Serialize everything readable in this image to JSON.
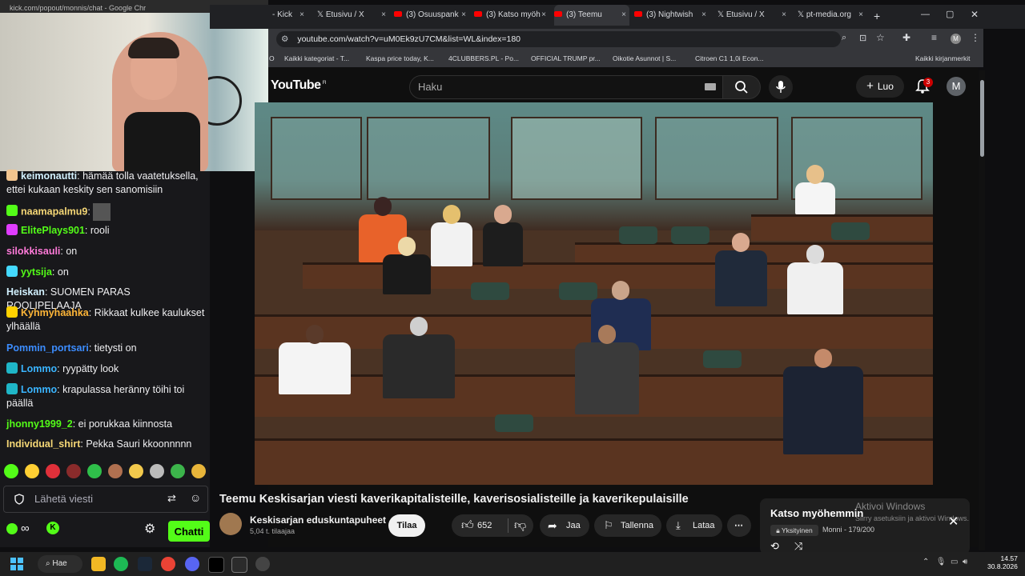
{
  "webcam": {
    "tab_text": "kick.com/popout/monnis/chat - Google Chr"
  },
  "chat": {
    "messages": [
      {
        "name": "keimonautti",
        "color": "#d2f1ff",
        "text": "hämää tolla vaatetuksella, ettei kukaan keskity sen sanomisiin",
        "badge": "#f3c58f"
      },
      {
        "name": "naamapalmu9",
        "color": "#f5d776",
        "text": "",
        "badge": "#53fc18"
      },
      {
        "name": "ElitePlays901",
        "color": "#53fc18",
        "text": "rooli",
        "badge": "#e03cff"
      },
      {
        "name": "silokkisauli",
        "color": "#ff7ad9",
        "text": "on",
        "badge": ""
      },
      {
        "name": "yytsija",
        "color": "#53fc18",
        "text": "on",
        "badge": "#44d9ff"
      },
      {
        "name": "Heiskan",
        "color": "#d2f1ff",
        "text": "SUOMEN PARAS ROOLIPELAAJA",
        "badge": ""
      },
      {
        "name": "Kyhmyhaahka",
        "color": "#ffb638",
        "text": "Rikkaat kulkee kaulukset ylhäällä",
        "badge": "#ffd200"
      },
      {
        "name": "Pommin_portsari",
        "color": "#3c8dff",
        "text": "tietysti on",
        "badge": ""
      },
      {
        "name": "Lommo",
        "color": "#3ab5ff",
        "text": "ryypätty look",
        "badge": "#1fb6c7"
      },
      {
        "name": "Lommo",
        "color": "#3ab5ff",
        "text": "krapulassa heränny töihi toi päällä",
        "badge": "#1fb6c7"
      },
      {
        "name": "jhonny1999_2",
        "color": "#53fc18",
        "text": "ei porukkaa kiinnosta",
        "badge": ""
      },
      {
        "name": "Individual_shirt",
        "color": "#f5d776",
        "text": "Pekka Sauri kkoonnnnn",
        "badge": ""
      }
    ],
    "input_placeholder": "Lähetä viesti",
    "send_label": "Chatti"
  },
  "browser": {
    "tabs": [
      {
        "label": "- Kick",
        "icon": "kick-icon"
      },
      {
        "label": "Etusivu / X",
        "icon": "x-icon"
      },
      {
        "label": "(3) Osuuspank",
        "icon": "youtube-icon"
      },
      {
        "label": "(3) Katso myöh",
        "icon": "youtube-icon"
      },
      {
        "label": "(3) Teemu",
        "icon": "youtube-icon"
      },
      {
        "label": "(3) Nightwish",
        "icon": "youtube-icon"
      },
      {
        "label": "Etusivu / X",
        "icon": "x-icon"
      },
      {
        "label": "pt-media.org",
        "icon": "x-icon"
      }
    ],
    "url": "youtube.com/watch?v=uM0Ek9zU7CM&list=WL&index=180",
    "bookmarks": [
      "O",
      "Kaikki kategoriat - T...",
      "Kaspa price today, K...",
      "4CLUBBERS.PL - Po...",
      "OFFICIAL TRUMP pr...",
      "Oikotie Asunnot | S...",
      "Citroen C1 1,0i Econ...",
      "Kaikki kirjanmerkit"
    ]
  },
  "youtube": {
    "logo": "YouTube",
    "logo_region": "FI",
    "search_placeholder": "Haku",
    "create_label": "Luo",
    "notification_count": "3",
    "avatar_letter": "M",
    "video_title": "Teemu Keskisarjan viesti kaverikapitalisteille, kaverisosialisteille ja kaverikepulaisille",
    "channel_name": "Keskisarjan eduskuntapuheet",
    "channel_subs": "5,04 t. tilaajaa",
    "subscribe_label": "Tilaa",
    "like_count": "652",
    "share_label": "Jaa",
    "save_label": "Tallenna",
    "download_label": "Lataa",
    "watch_later_title": "Katso myöhemmin",
    "privacy_label": "Yksityinen",
    "playlist_owner": "Monni - 179/200",
    "activate_windows": "Aktivoi Windows",
    "activate_windows_sub": "Siirry asetuksiin ja aktivoi Windows."
  },
  "taskbar": {
    "search_label": "Hae",
    "time": "14.57",
    "date": "30.8.2026"
  },
  "colors": {
    "kick_green": "#53fc18",
    "youtube_red": "#ff0000",
    "chat_bg": "#18181b"
  }
}
